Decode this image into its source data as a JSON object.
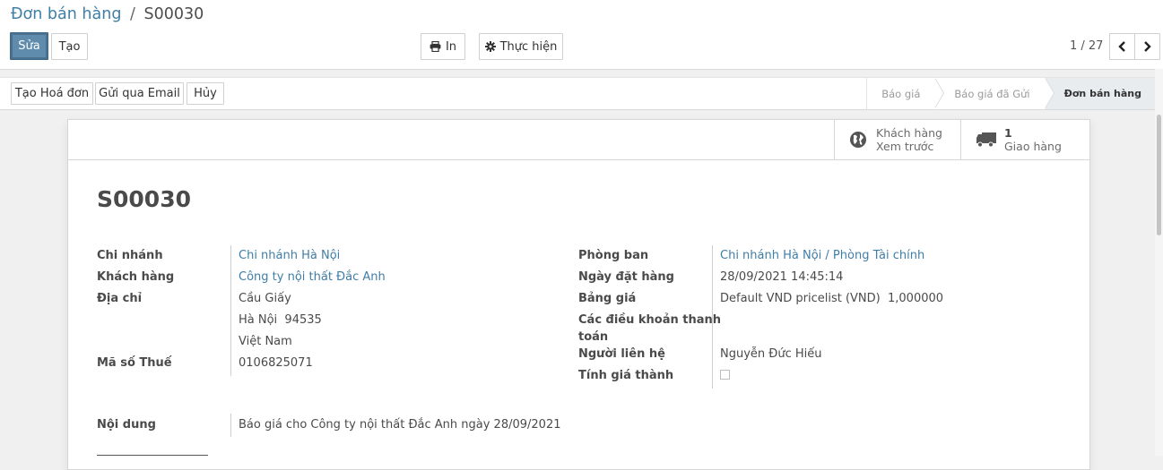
{
  "breadcrumb": {
    "parent": "Đơn bán hàng",
    "separator": "/",
    "current": "S00030"
  },
  "toolbar": {
    "edit_label": "Sửa",
    "create_label": "Tạo",
    "print_label": "In",
    "action_label": "Thực hiện",
    "pager_text": "1 / 27"
  },
  "statusbar": {
    "buttons": [
      "Tạo Hoá đơn",
      "Gửi qua Email",
      "Hủy"
    ],
    "stages": [
      {
        "label": "Báo giá",
        "active": false
      },
      {
        "label": "Báo giá đã Gửi",
        "active": false
      },
      {
        "label": "Đơn bán hàng",
        "active": true
      }
    ]
  },
  "smart_buttons": {
    "customer_preview": {
      "line1": "Khách hàng",
      "line2": "Xem trước",
      "icon": "globe-icon"
    },
    "delivery": {
      "count": "1",
      "label": "Giao hàng",
      "icon": "truck-icon"
    }
  },
  "record": {
    "title": "S00030",
    "left": {
      "branch_label": "Chi nhánh",
      "branch_value": "Chi nhánh Hà Nội",
      "customer_label": "Khách hàng",
      "customer_value": "Công ty nội thất Đắc Anh",
      "address_label": "Địa chỉ",
      "address_line1": "Cầu Giấy",
      "address_line2": "Hà Nội  94535",
      "address_line3": "Việt Nam",
      "tax_label": "Mã số Thuế",
      "tax_value": "0106825071"
    },
    "right": {
      "department_label": "Phòng ban",
      "department_value": "Chi nhánh Hà Nội / Phòng Tài chính",
      "order_date_label": "Ngày đặt hàng",
      "order_date_value": "28/09/2021 14:45:14",
      "pricelist_label": "Bảng giá",
      "pricelist_value": "Default VND pricelist (VND)  1,000000",
      "payment_terms_label_1": "Các điều khoản thanh",
      "payment_terms_label_2": "toán",
      "contact_label": "Người liên hệ",
      "contact_value": "Nguyễn Đức Hiếu",
      "costing_label": "Tính giá thành",
      "costing_checked": false
    },
    "content_label": "Nội dung",
    "content_value": "Báo giá cho Công ty nội thất Đắc Anh ngày 28/09/2021"
  },
  "colors": {
    "accent": "#5f8bac",
    "link": "#3f7ea6",
    "text": "#4a4a4a"
  }
}
